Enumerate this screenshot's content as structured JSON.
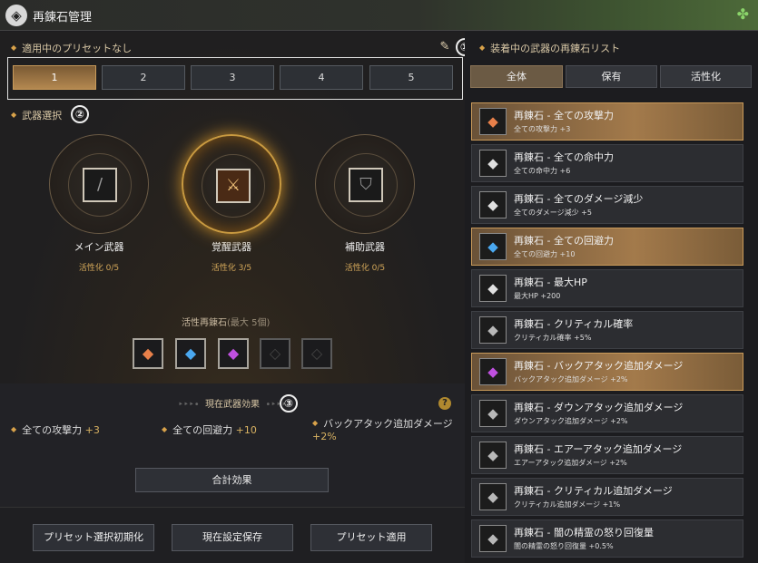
{
  "title": "再錬石管理",
  "presets": {
    "label": "適用中のプリセットなし",
    "buttons": [
      "1",
      "2",
      "3",
      "4",
      "5"
    ],
    "active_index": 0
  },
  "weapon_select": {
    "label": "武器選択",
    "weapons": [
      {
        "name": "メイン武器",
        "status": "活性化 0/5"
      },
      {
        "name": "覚醒武器",
        "status": "活性化 3/5"
      },
      {
        "name": "補助武器",
        "status": "活性化 0/5"
      }
    ],
    "active_title": "活性再錬石",
    "active_max": "(最大 5個)"
  },
  "current_effects": {
    "title": "現在武器効果",
    "items": [
      {
        "name": "全ての攻撃力",
        "value": "+3"
      },
      {
        "name": "全ての回避力",
        "value": "+10"
      },
      {
        "name": "バックアタック追加ダメージ",
        "value": "+2%"
      }
    ],
    "total_button": "合計効果"
  },
  "bottom_buttons": [
    "プリセット選択初期化",
    "現在設定保存",
    "プリセット適用"
  ],
  "callouts": [
    "①",
    "②",
    "③"
  ],
  "right_panel": {
    "title": "装着中の武器の再錬石リスト",
    "tabs": [
      "全体",
      "保有",
      "活性化"
    ],
    "active_tab": 0,
    "items": [
      {
        "name": "再錬石 - 全ての攻撃力",
        "desc": "全ての攻撃力 +3",
        "highlight": true,
        "icon": "orange-stone-icon"
      },
      {
        "name": "再錬石 - 全ての命中力",
        "desc": "全ての命中力 +6",
        "highlight": false,
        "icon": "white-stone-icon"
      },
      {
        "name": "再錬石 - 全てのダメージ減少",
        "desc": "全てのダメージ減少 +5",
        "highlight": false,
        "icon": "white-stone-icon"
      },
      {
        "name": "再錬石 - 全ての回避力",
        "desc": "全ての回避力 +10",
        "highlight": true,
        "icon": "blue-stone-icon"
      },
      {
        "name": "再錬石 - 最大HP",
        "desc": "最大HP +200",
        "highlight": false,
        "icon": "white-stone-icon"
      },
      {
        "name": "再錬石 - クリティカル確率",
        "desc": "クリティカル確率 +5%",
        "highlight": false,
        "icon": "silver-stone-icon"
      },
      {
        "name": "再錬石 - バックアタック追加ダメージ",
        "desc": "バックアタック追加ダメージ +2%",
        "highlight": true,
        "icon": "purple-stone-icon"
      },
      {
        "name": "再錬石 - ダウンアタック追加ダメージ",
        "desc": "ダウンアタック追加ダメージ +2%",
        "highlight": false,
        "icon": "silver-stone-icon"
      },
      {
        "name": "再錬石 - エアーアタック追加ダメージ",
        "desc": "エアーアタック追加ダメージ +2%",
        "highlight": false,
        "icon": "silver-stone-icon"
      },
      {
        "name": "再錬石 - クリティカル追加ダメージ",
        "desc": "クリティカル追加ダメージ +1%",
        "highlight": false,
        "icon": "silver-stone-icon"
      },
      {
        "name": "再錬石 - 闇の精霊の怒り回復量",
        "desc": "闇の精霊の怒り回復量 +0.5%",
        "highlight": false,
        "icon": "silver-stone-icon"
      }
    ]
  },
  "colors": {
    "accent": "#d8a24a",
    "highlight": "#a37a4b",
    "orange_stone": "#e8804a",
    "blue_stone": "#4aa8f0",
    "purple_stone": "#c050e0"
  }
}
